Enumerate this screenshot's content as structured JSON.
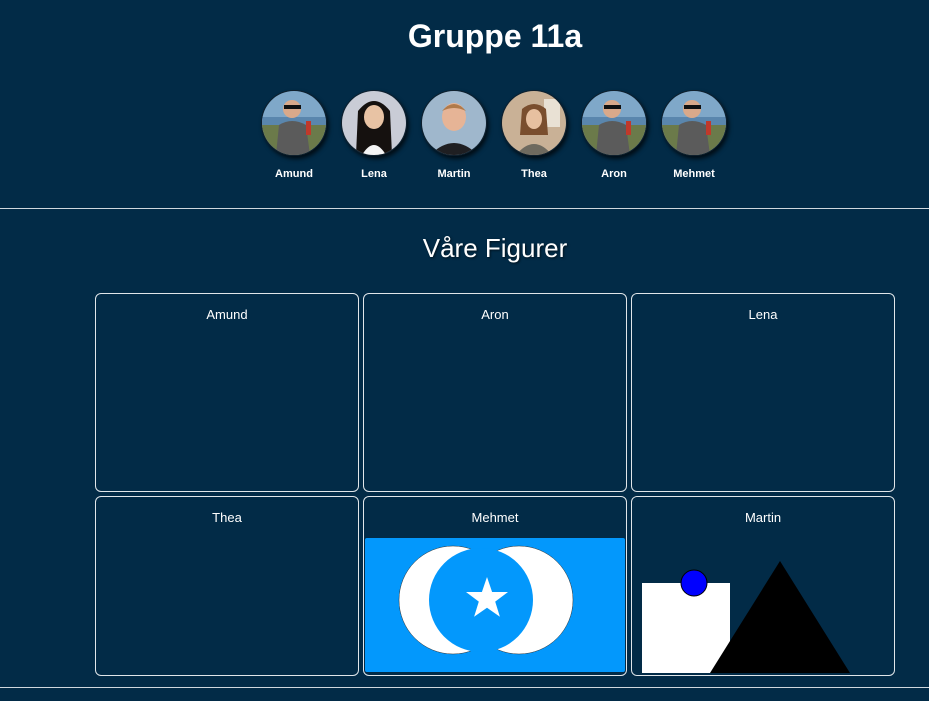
{
  "header": {
    "title": "Gruppe 11a",
    "members": [
      {
        "name": "Amund"
      },
      {
        "name": "Lena"
      },
      {
        "name": "Martin"
      },
      {
        "name": "Thea"
      },
      {
        "name": "Aron"
      },
      {
        "name": "Mehmet"
      }
    ]
  },
  "figures_section": {
    "title": "Våre Figurer",
    "cards": [
      {
        "name": "Amund"
      },
      {
        "name": "Aron"
      },
      {
        "name": "Lena"
      },
      {
        "name": "Thea"
      },
      {
        "name": "Mehmet"
      },
      {
        "name": "Martin"
      }
    ]
  },
  "colors": {
    "background": "#022b47",
    "flag_blue": "#0398fc",
    "circle_blue": "#0000ff"
  }
}
